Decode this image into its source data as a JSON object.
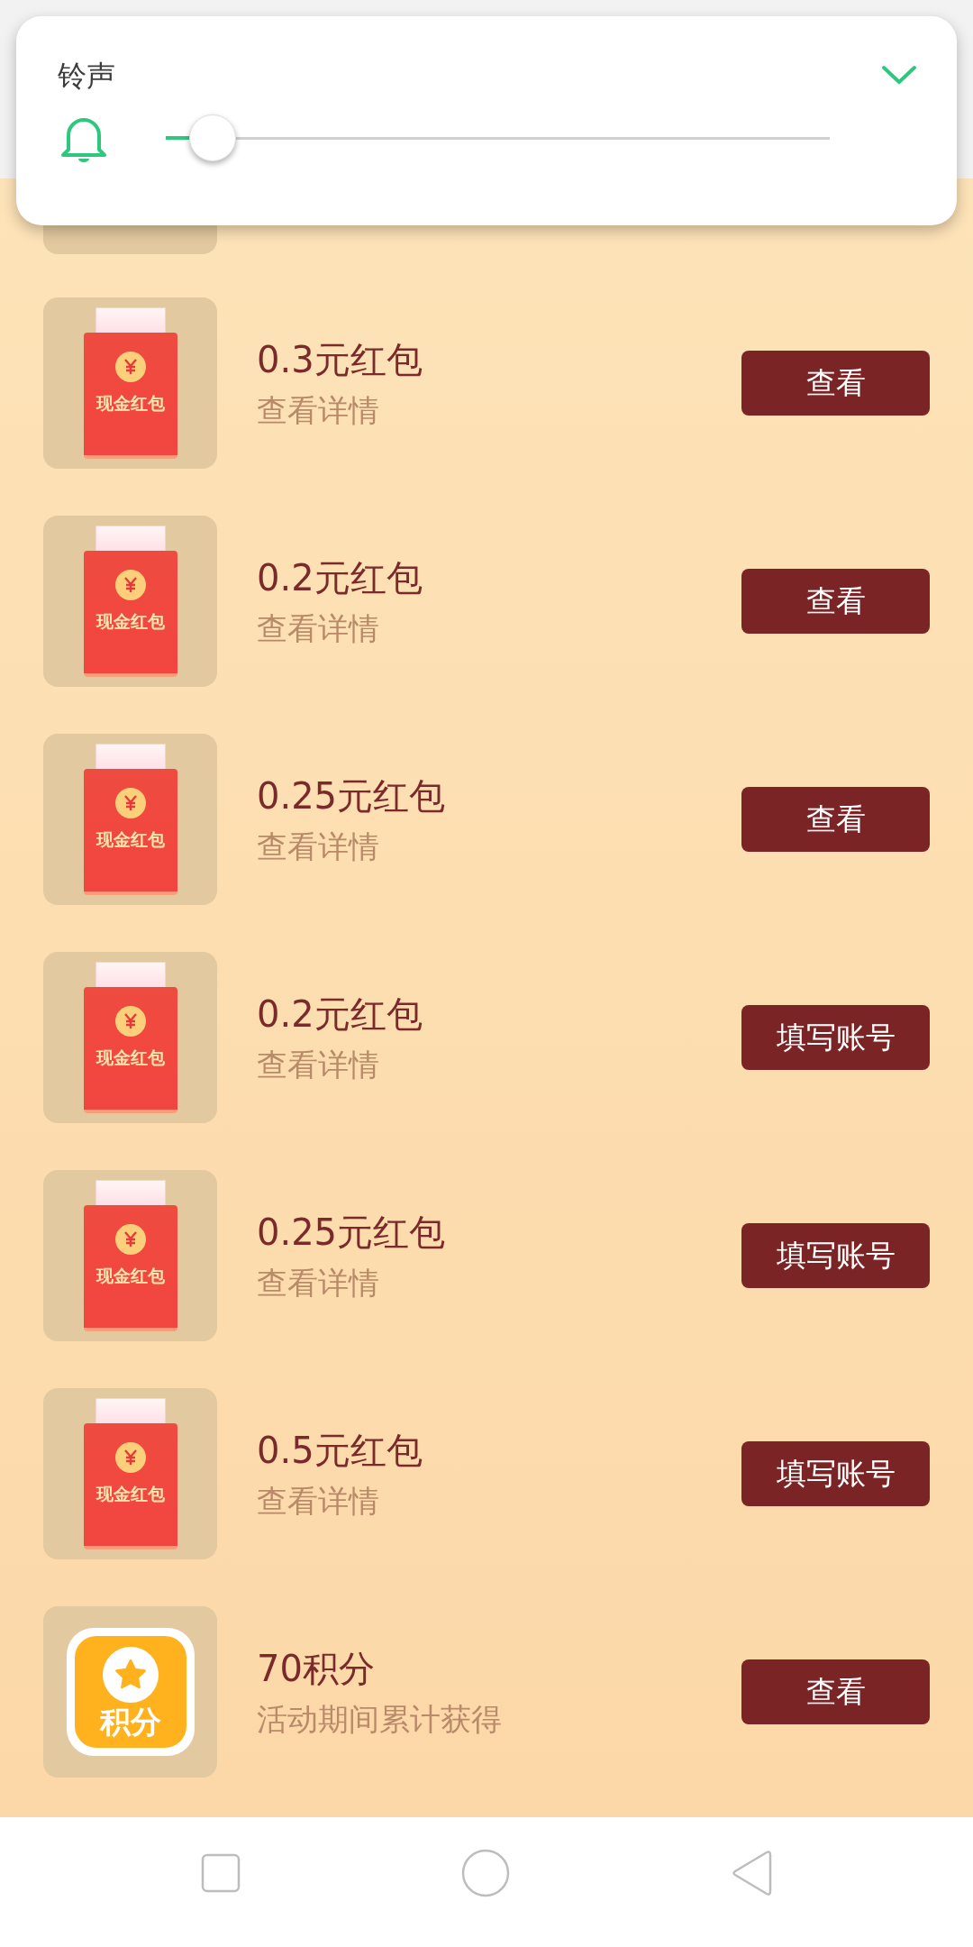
{
  "volume_panel": {
    "title": "铃声",
    "level": 0.07
  },
  "rewards": [
    {
      "kind": "cash",
      "icon_label": "现金红包",
      "title": "0.3元红包",
      "subtitle": "查看详情",
      "action": "查看"
    },
    {
      "kind": "cash",
      "icon_label": "现金红包",
      "title": "0.2元红包",
      "subtitle": "查看详情",
      "action": "查看"
    },
    {
      "kind": "cash",
      "icon_label": "现金红包",
      "title": "0.25元红包",
      "subtitle": "查看详情",
      "action": "查看"
    },
    {
      "kind": "cash",
      "icon_label": "现金红包",
      "title": "0.2元红包",
      "subtitle": "查看详情",
      "action": "填写账号"
    },
    {
      "kind": "cash",
      "icon_label": "现金红包",
      "title": "0.25元红包",
      "subtitle": "查看详情",
      "action": "填写账号"
    },
    {
      "kind": "cash",
      "icon_label": "现金红包",
      "title": "0.5元红包",
      "subtitle": "查看详情",
      "action": "填写账号"
    },
    {
      "kind": "points",
      "icon_label": "积分",
      "title": "70积分",
      "subtitle": "活动期间累计获得",
      "action": "查看"
    }
  ]
}
